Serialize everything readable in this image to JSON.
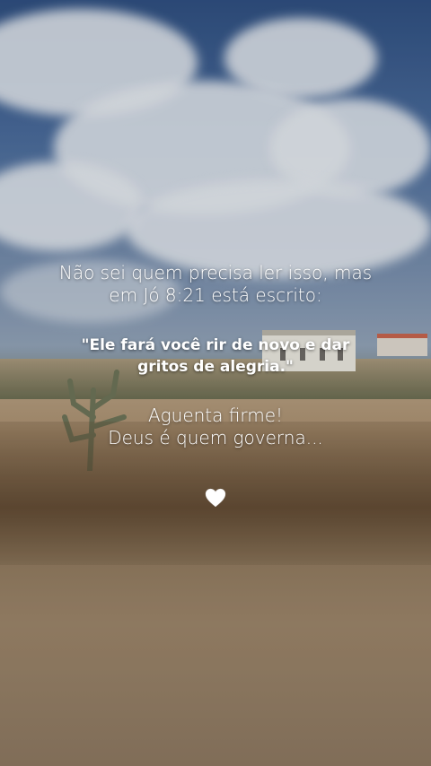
{
  "post": {
    "intro_line_1": "Não sei quem precisa ler isso, mas",
    "intro_line_2": "em Jó 8:21 está escrito:",
    "quote_line_1": "\"Ele fará você rir de novo e dar",
    "quote_line_2": "gritos de alegria.\"",
    "closing_line_1": "Aguenta firme!",
    "closing_line_2": "Deus é quem governa...",
    "heart_icon": "white-heart-icon"
  },
  "colors": {
    "text": "#ffffff",
    "sky": "#4b6c9b",
    "ground": "#a98f70"
  }
}
